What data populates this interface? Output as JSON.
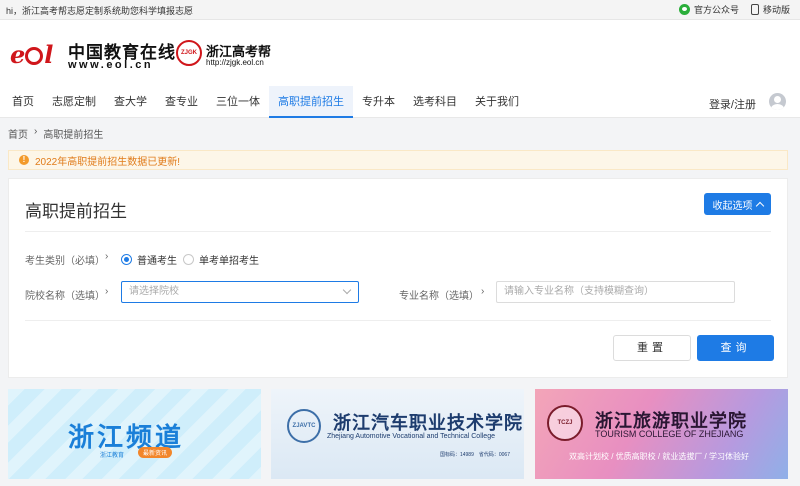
{
  "topbar": {
    "greeting": "hi，浙江高考帮志愿定制系统助您科学填报志愿",
    "wechat_label": "官方公众号",
    "mobile_label": "移动版"
  },
  "logos": {
    "eol_cn": "中国教育在线",
    "eol_url": "www.eol.cn",
    "zj_title": "浙江高考帮",
    "zj_url": "http://zjgk.eol.cn"
  },
  "nav": {
    "items": [
      {
        "label": "首页"
      },
      {
        "label": "志愿定制"
      },
      {
        "label": "查大学"
      },
      {
        "label": "查专业"
      },
      {
        "label": "三位一体"
      },
      {
        "label": "高职提前招生"
      },
      {
        "label": "专升本"
      },
      {
        "label": "选考科目"
      },
      {
        "label": "关于我们"
      }
    ],
    "active_index": 5,
    "login_label": "登录/注册"
  },
  "breadcrumb": {
    "home": "首页",
    "separator": "›",
    "current": "高职提前招生"
  },
  "notice": {
    "icon": "!",
    "text": "2022年高职提前招生数据已更新!"
  },
  "panel": {
    "title": "高职提前招生",
    "collapse_label": "收起选项",
    "category_label": "考生类别（必填）",
    "arrow": "›",
    "options": [
      {
        "label": "普通考生",
        "checked": true
      },
      {
        "label": "单考单招考生",
        "checked": false
      }
    ],
    "school_label": "院校名称（选填）",
    "school_placeholder": "请选择院校",
    "major_label": "专业名称（选填）",
    "major_placeholder": "请输入专业名称（支持模糊查询）",
    "reset_label": "重置",
    "query_label": "查询"
  },
  "banners": [
    {
      "title": "浙江频道",
      "tag1": "浙江教育",
      "tag2": "最新资讯"
    },
    {
      "title": "浙江汽车职业技术学院",
      "subtitle": "Zhejiang Automotive Vocational and Technical College",
      "code": "国标码：14989　省代码：0067"
    },
    {
      "title": "浙江旅游职业学院",
      "subtitle": "TOURISM COLLEGE OF ZHEJIANG",
      "slogan": "双高计划校 / 优质高职校 / 就业选拔厂 / 学习体验好"
    }
  ],
  "colors": {
    "accent": "#1e7be5",
    "notice_text": "#e07b1a",
    "notice_bg": "#fdf6e8",
    "brand_red": "#d0161b"
  }
}
